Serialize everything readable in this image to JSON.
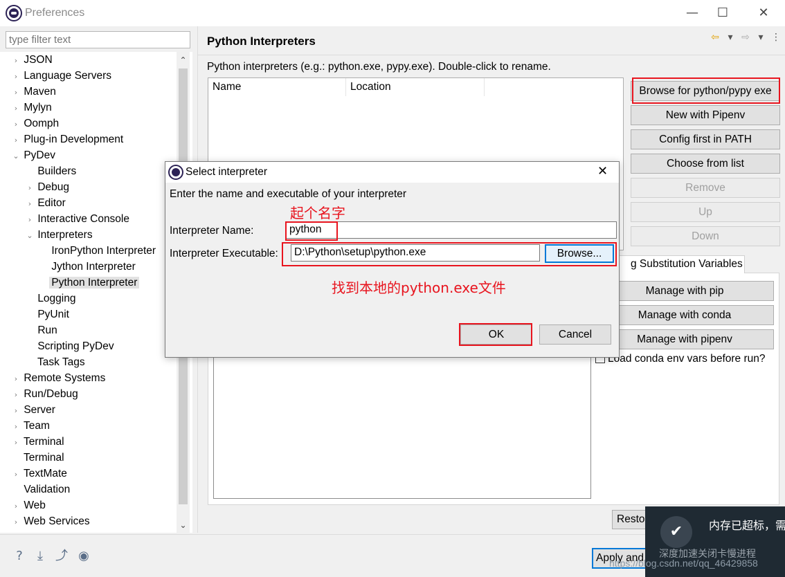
{
  "window": {
    "title": "Preferences",
    "minimize_glyph": "—",
    "maximize_glyph": "☐",
    "close_glyph": "✕"
  },
  "filter": {
    "placeholder": "type filter text"
  },
  "tree": [
    {
      "label": "JSON",
      "level": 0,
      "toggle": "›"
    },
    {
      "label": "Language Servers",
      "level": 0,
      "toggle": "›"
    },
    {
      "label": "Maven",
      "level": 0,
      "toggle": "›"
    },
    {
      "label": "Mylyn",
      "level": 0,
      "toggle": "›"
    },
    {
      "label": "Oomph",
      "level": 0,
      "toggle": "›"
    },
    {
      "label": "Plug-in Development",
      "level": 0,
      "toggle": "›"
    },
    {
      "label": "PyDev",
      "level": 0,
      "toggle": "⌄"
    },
    {
      "label": "Builders",
      "level": 1,
      "toggle": ""
    },
    {
      "label": "Debug",
      "level": 1,
      "toggle": "›"
    },
    {
      "label": "Editor",
      "level": 1,
      "toggle": "›"
    },
    {
      "label": "Interactive Console",
      "level": 1,
      "toggle": "›"
    },
    {
      "label": "Interpreters",
      "level": 1,
      "toggle": "⌄"
    },
    {
      "label": "IronPython Interpreter",
      "level": 2,
      "toggle": ""
    },
    {
      "label": "Jython Interpreter",
      "level": 2,
      "toggle": ""
    },
    {
      "label": "Python Interpreter",
      "level": 2,
      "toggle": "",
      "selected": true
    },
    {
      "label": "Logging",
      "level": 1,
      "toggle": ""
    },
    {
      "label": "PyUnit",
      "level": 1,
      "toggle": ""
    },
    {
      "label": "Run",
      "level": 1,
      "toggle": ""
    },
    {
      "label": "Scripting PyDev",
      "level": 1,
      "toggle": ""
    },
    {
      "label": "Task Tags",
      "level": 1,
      "toggle": ""
    },
    {
      "label": "Remote Systems",
      "level": 0,
      "toggle": "›"
    },
    {
      "label": "Run/Debug",
      "level": 0,
      "toggle": "›"
    },
    {
      "label": "Server",
      "level": 0,
      "toggle": "›"
    },
    {
      "label": "Team",
      "level": 0,
      "toggle": "›"
    },
    {
      "label": "Terminal",
      "level": 0,
      "toggle": "›"
    },
    {
      "label": "Terminal",
      "level": 0,
      "toggle": ""
    },
    {
      "label": "TextMate",
      "level": 0,
      "toggle": "›"
    },
    {
      "label": "Validation",
      "level": 0,
      "toggle": ""
    },
    {
      "label": "Web",
      "level": 0,
      "toggle": "›"
    },
    {
      "label": "Web Services",
      "level": 0,
      "toggle": "›"
    }
  ],
  "main": {
    "title": "Python Interpreters",
    "description": "Python interpreters (e.g.: python.exe, pypy.exe).   Double-click to rename.",
    "table_columns": [
      "Name",
      "Location"
    ],
    "buttons": [
      {
        "label": "Browse for python/pypy exe",
        "enabled": true
      },
      {
        "label": "New with Pipenv",
        "enabled": true
      },
      {
        "label": "Config first in PATH",
        "enabled": true
      },
      {
        "label": "Choose from list",
        "enabled": true
      },
      {
        "label": "Remove",
        "enabled": false
      },
      {
        "label": "Up",
        "enabled": false
      },
      {
        "label": "Down",
        "enabled": false
      }
    ],
    "tab_partial": "g Substitution Variables",
    "manage_buttons": [
      "Manage with pip",
      "Manage with conda",
      "Manage with pipenv"
    ],
    "conda_checkbox": "Load conda env vars before run?",
    "restore_partial": "Resto",
    "apply_partial": "Apply and"
  },
  "dialog": {
    "title": "Select interpreter",
    "close_glyph": "✕",
    "subtitle": "Enter the name and executable of your interpreter",
    "name_label": "Interpreter Name:",
    "name_value": "python",
    "exe_label": "Interpreter Executable:",
    "exe_value": "D:\\Python\\setup\\python.exe",
    "browse_label": "Browse...",
    "ok_label": "OK",
    "cancel_label": "Cancel",
    "annotation_name": "起个名字",
    "annotation_exe": "找到本地的python.exe文件"
  },
  "toast": {
    "message": "内存已超标，需",
    "sub": "深度加速关闭卡慢进程",
    "icon": "✔"
  },
  "watermark": "https://blog.csdn.net/qq_46429858",
  "colors": {
    "annotation_red": "#e8141e",
    "focus_blue": "#0078d7"
  }
}
